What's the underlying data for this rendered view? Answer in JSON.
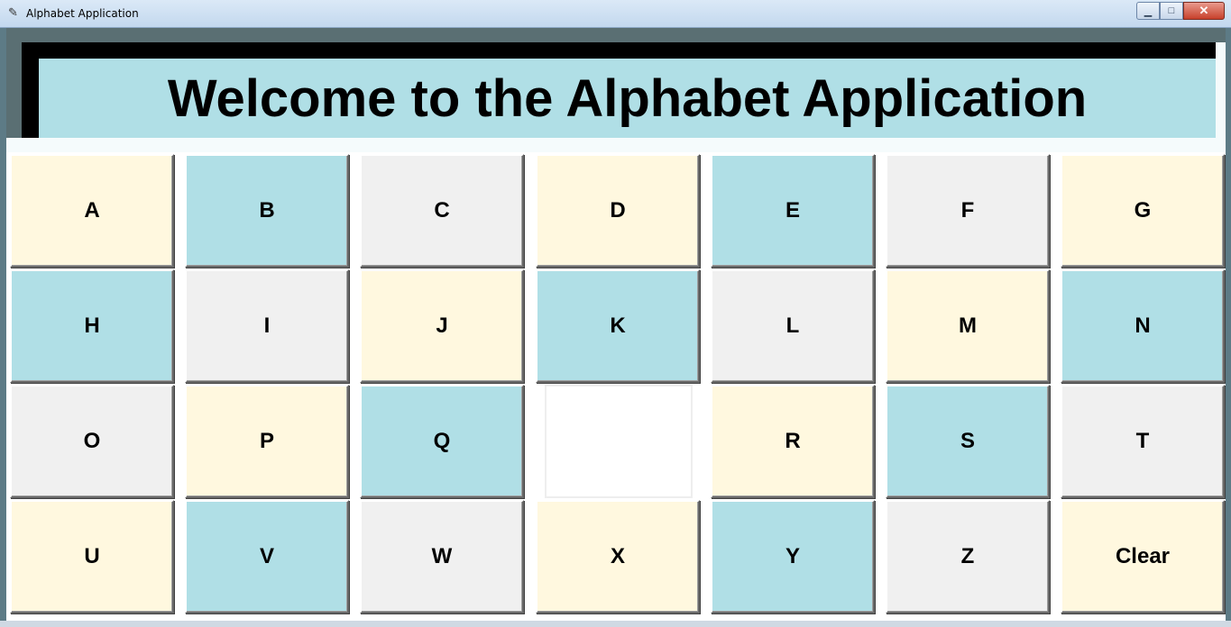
{
  "window": {
    "title": "Alphabet Application",
    "minimize": "▁",
    "maximize": "□",
    "close": "✕"
  },
  "header": {
    "title": "Welcome to the Alphabet Application"
  },
  "colors": {
    "cream": "#fff8df",
    "blue": "#b0dfe6",
    "grey": "#f0f0f0",
    "white": "#ffffff"
  },
  "buttons": [
    {
      "label": "A",
      "color": "cream"
    },
    {
      "label": "B",
      "color": "blue"
    },
    {
      "label": "C",
      "color": "grey"
    },
    {
      "label": "D",
      "color": "cream"
    },
    {
      "label": "E",
      "color": "blue"
    },
    {
      "label": "F",
      "color": "grey"
    },
    {
      "label": "G",
      "color": "cream"
    },
    {
      "label": "H",
      "color": "blue"
    },
    {
      "label": "I",
      "color": "grey"
    },
    {
      "label": "J",
      "color": "cream"
    },
    {
      "label": "K",
      "color": "blue"
    },
    {
      "label": "L",
      "color": "grey"
    },
    {
      "label": "M",
      "color": "cream"
    },
    {
      "label": "N",
      "color": "blue"
    },
    {
      "label": "O",
      "color": "grey"
    },
    {
      "label": "P",
      "color": "cream"
    },
    {
      "label": "Q",
      "color": "blue"
    },
    {
      "label": "",
      "color": "white"
    },
    {
      "label": "R",
      "color": "cream"
    },
    {
      "label": "S",
      "color": "blue"
    },
    {
      "label": "T",
      "color": "grey"
    },
    {
      "label": "U",
      "color": "cream"
    },
    {
      "label": "V",
      "color": "blue"
    },
    {
      "label": "W",
      "color": "grey"
    },
    {
      "label": "X",
      "color": "cream"
    },
    {
      "label": "Y",
      "color": "blue"
    },
    {
      "label": "Z",
      "color": "grey"
    },
    {
      "label": "Clear",
      "color": "cream"
    }
  ]
}
